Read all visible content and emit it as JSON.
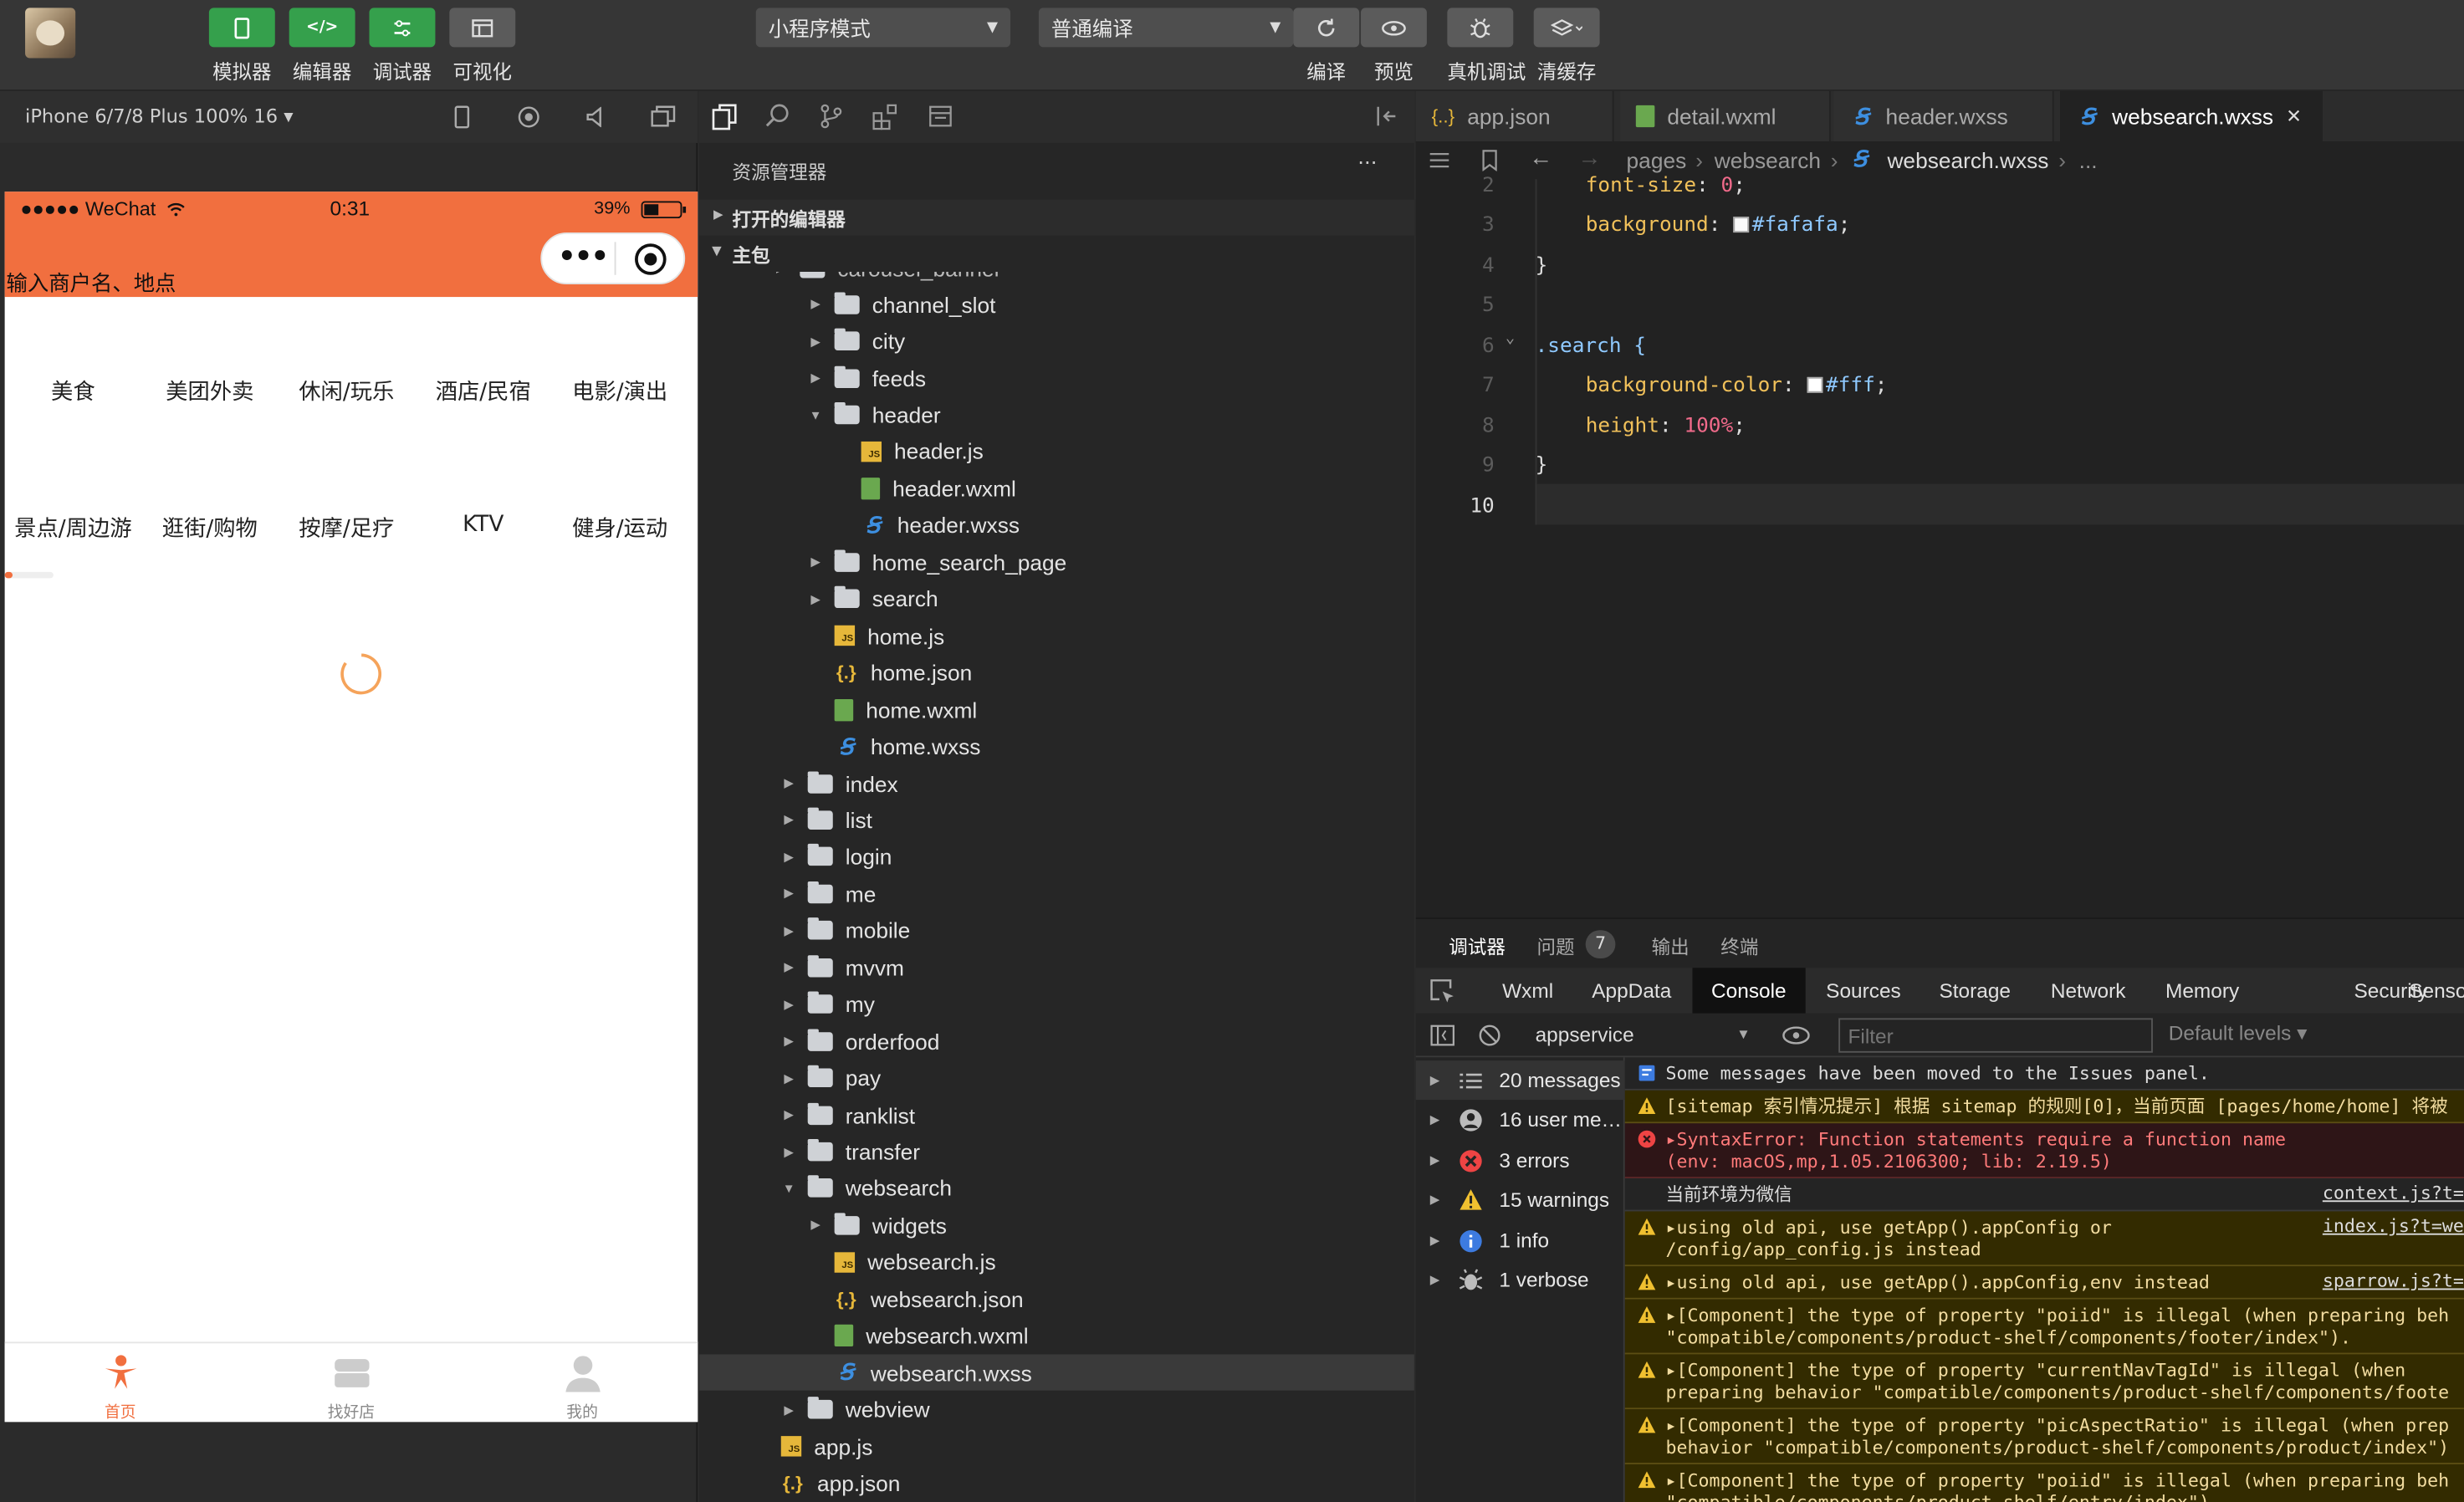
{
  "toolbar": {
    "buttons": [
      {
        "label": "模拟器"
      },
      {
        "label": "编辑器"
      },
      {
        "label": "调试器"
      },
      {
        "label": "可视化"
      }
    ],
    "mode_select": "小程序模式",
    "compile_select": "普通编译",
    "right_buttons": [
      {
        "label": "编译"
      },
      {
        "label": "预览"
      },
      {
        "label": "真机调试"
      },
      {
        "label": "清缓存"
      }
    ]
  },
  "simulator": {
    "device": "iPhone 6/7/8 Plus 100% 16 ▾",
    "status_left": "●●●●● WeChat",
    "status_time": "0:31",
    "status_battery": "39%",
    "search_placeholder": "输入商户名、地点",
    "categories_row1": [
      "美食",
      "美团外卖",
      "休闲/玩乐",
      "酒店/民宿",
      "电影/演出"
    ],
    "categories_row2": [
      "景点/周边游",
      "逛街/购物",
      "按摩/足疗",
      "KTV",
      "健身/运动"
    ],
    "tabbar": [
      {
        "label": "首页",
        "active": true
      },
      {
        "label": "找好店",
        "active": false
      },
      {
        "label": "我的",
        "active": false
      }
    ]
  },
  "explorer": {
    "title": "资源管理器",
    "more": "···",
    "section_open": "打开的编辑器",
    "section_main": "主包",
    "partial_top": "carousel_banner",
    "tree": [
      {
        "name": "channel_slot",
        "type": "folder",
        "depth": 2,
        "caret": "▸"
      },
      {
        "name": "city",
        "type": "folder",
        "depth": 2,
        "caret": "▸"
      },
      {
        "name": "feeds",
        "type": "folder",
        "depth": 2,
        "caret": "▸"
      },
      {
        "name": "header",
        "type": "folder",
        "depth": 2,
        "caret": "▾"
      },
      {
        "name": "header.js",
        "type": "js",
        "depth": 3,
        "caret": ""
      },
      {
        "name": "header.wxml",
        "type": "wxml",
        "depth": 3,
        "caret": ""
      },
      {
        "name": "header.wxss",
        "type": "wxss",
        "depth": 3,
        "caret": ""
      },
      {
        "name": "home_search_page",
        "type": "folder",
        "depth": 2,
        "caret": "▸"
      },
      {
        "name": "search",
        "type": "folder",
        "depth": 2,
        "caret": "▸"
      },
      {
        "name": "home.js",
        "type": "js",
        "depth": 2,
        "caret": ""
      },
      {
        "name": "home.json",
        "type": "json",
        "depth": 2,
        "caret": ""
      },
      {
        "name": "home.wxml",
        "type": "wxml",
        "depth": 2,
        "caret": ""
      },
      {
        "name": "home.wxss",
        "type": "wxss",
        "depth": 2,
        "caret": ""
      },
      {
        "name": "index",
        "type": "folder",
        "depth": 1,
        "caret": "▸"
      },
      {
        "name": "list",
        "type": "folder",
        "depth": 1,
        "caret": "▸"
      },
      {
        "name": "login",
        "type": "folder",
        "depth": 1,
        "caret": "▸"
      },
      {
        "name": "me",
        "type": "folder",
        "depth": 1,
        "caret": "▸"
      },
      {
        "name": "mobile",
        "type": "folder",
        "depth": 1,
        "caret": "▸"
      },
      {
        "name": "mvvm",
        "type": "folder",
        "depth": 1,
        "caret": "▸"
      },
      {
        "name": "my",
        "type": "folder",
        "depth": 1,
        "caret": "▸"
      },
      {
        "name": "orderfood",
        "type": "folder",
        "depth": 1,
        "caret": "▸"
      },
      {
        "name": "pay",
        "type": "folder",
        "depth": 1,
        "caret": "▸"
      },
      {
        "name": "ranklist",
        "type": "folder",
        "depth": 1,
        "caret": "▸"
      },
      {
        "name": "transfer",
        "type": "folder",
        "depth": 1,
        "caret": "▸"
      },
      {
        "name": "websearch",
        "type": "folder",
        "depth": 1,
        "caret": "▾"
      },
      {
        "name": "widgets",
        "type": "folder",
        "depth": 2,
        "caret": "▸"
      },
      {
        "name": "websearch.js",
        "type": "js",
        "depth": 2,
        "caret": ""
      },
      {
        "name": "websearch.json",
        "type": "json",
        "depth": 2,
        "caret": ""
      },
      {
        "name": "websearch.wxml",
        "type": "wxml",
        "depth": 2,
        "caret": ""
      },
      {
        "name": "websearch.wxss",
        "type": "wxss",
        "depth": 2,
        "caret": "",
        "selected": true
      },
      {
        "name": "webview",
        "type": "folder",
        "depth": 1,
        "caret": "▸"
      },
      {
        "name": "app.js",
        "type": "js",
        "depth": 0,
        "caret": ""
      },
      {
        "name": "app.json",
        "type": "json",
        "depth": 0,
        "caret": ""
      }
    ]
  },
  "editor": {
    "tabs": [
      {
        "label": "app.json",
        "type": "json",
        "active": false
      },
      {
        "label": "detail.wxml",
        "type": "wxml",
        "active": false
      },
      {
        "label": "header.wxss",
        "type": "wxss",
        "active": false
      },
      {
        "label": "websearch.wxss",
        "type": "wxss",
        "active": true
      }
    ],
    "close": "✕",
    "breadcrumb": [
      "pages",
      "websearch",
      "websearch.wxss",
      "..."
    ],
    "lines": [
      {
        "n": "2",
        "code": "font-size: 0;"
      },
      {
        "n": "3",
        "code": "background: #fafafa;"
      },
      {
        "n": "4",
        "code": "}"
      },
      {
        "n": "5",
        "code": ""
      },
      {
        "n": "6",
        "code": ".search {"
      },
      {
        "n": "7",
        "code": "background-color: #fff;"
      },
      {
        "n": "8",
        "code": "height: 100%;"
      },
      {
        "n": "9",
        "code": "}"
      },
      {
        "n": "10",
        "code": ""
      }
    ]
  },
  "devtools": {
    "top_tabs": [
      "调试器",
      "问题",
      "输出",
      "终端"
    ],
    "issues_count": "7",
    "panel_tabs": [
      "Wxml",
      "AppData",
      "Console",
      "Sources",
      "Storage",
      "Network",
      "Memory",
      "Security",
      "Senso"
    ],
    "context": "appservice",
    "filter_placeholder": "Filter",
    "levels": "Default levels ▾",
    "side": [
      {
        "label": "20 messages",
        "icon": "list"
      },
      {
        "label": "16 user me…",
        "icon": "user"
      },
      {
        "label": "3 errors",
        "icon": "error"
      },
      {
        "label": "15 warnings",
        "icon": "warning"
      },
      {
        "label": "1 info",
        "icon": "info"
      },
      {
        "label": "1 verbose",
        "icon": "bug"
      }
    ],
    "messages": [
      {
        "kind": "info-blue",
        "text": "Some messages have been moved to the Issues panel.",
        "link": ""
      },
      {
        "kind": "warn",
        "text": "[sitemap 索引情况提示] 根据 sitemap 的规则[0]，当前页面 [pages/home/home] 将被",
        "link": ""
      },
      {
        "kind": "err",
        "text": "▸SyntaxError: Function statements require a function name\n(env: macOS,mp,1.05.2106300; lib: 2.19.5)",
        "link": ""
      },
      {
        "kind": "plain",
        "text": "当前环境为微信",
        "link": "context.js?t="
      },
      {
        "kind": "warn",
        "text": "▸using old api, use getApp().appConfig or\n/config/app_config.js instead",
        "link": "index.js?t=we"
      },
      {
        "kind": "warn",
        "text": "▸using old api, use getApp().appConfig,env instead",
        "link": "sparrow.js?t="
      },
      {
        "kind": "warn",
        "text": "▸[Component] the type of property \"poiid\" is illegal (when preparing beh\n\"compatible/components/product-shelf/components/footer/index\").",
        "link": ""
      },
      {
        "kind": "warn",
        "text": "▸[Component] the type of property \"currentNavTagId\" is illegal (when\npreparing behavior \"compatible/components/product-shelf/components/foote",
        "link": ""
      },
      {
        "kind": "warn",
        "text": "▸[Component] the type of property \"picAspectRatio\" is illegal (when prep\nbehavior \"compatible/components/product-shelf/components/product/index\")",
        "link": ""
      },
      {
        "kind": "warn",
        "text": "▸[Component] the type of property \"poiid\" is illegal (when preparing beh\n\"compatible/components/product-shelf/entry/index\").",
        "link": ""
      }
    ]
  }
}
